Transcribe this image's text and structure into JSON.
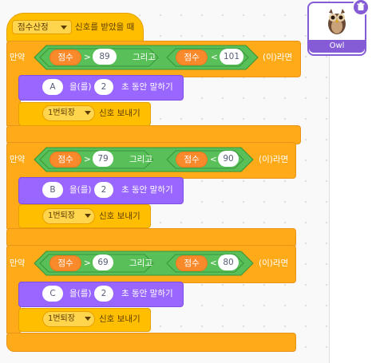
{
  "sprite": {
    "name": "Owl",
    "icon": "owl-image",
    "delete_icon": "trash-icon"
  },
  "hat": {
    "variable": "점수산정",
    "suffix": "신호를 받았을 때"
  },
  "if_blocks": [
    {
      "if_label": "만약",
      "then_label": "(이)라면",
      "and_label": "그리고",
      "cond1": {
        "var": "점수",
        "op": ">",
        "value": "89"
      },
      "cond2": {
        "var": "점수",
        "op": "<",
        "value": "101"
      },
      "say": {
        "text": "A",
        "mid": "을(를)",
        "secs": "2",
        "suffix": "초 동안 말하기"
      },
      "broadcast": {
        "message": "1번퇴장",
        "suffix": "신호 보내기"
      }
    },
    {
      "if_label": "만약",
      "then_label": "(이)라면",
      "and_label": "그리고",
      "cond1": {
        "var": "점수",
        "op": ">",
        "value": "79"
      },
      "cond2": {
        "var": "점수",
        "op": "<",
        "value": "90"
      },
      "say": {
        "text": "B",
        "mid": "을(를)",
        "secs": "2",
        "suffix": "초 동안 말하기"
      },
      "broadcast": {
        "message": "1번퇴장",
        "suffix": "신호 보내기"
      }
    },
    {
      "if_label": "만약",
      "then_label": "(이)라면",
      "and_label": "그리고",
      "cond1": {
        "var": "점수",
        "op": ">",
        "value": "69"
      },
      "cond2": {
        "var": "점수",
        "op": "<",
        "value": "80"
      },
      "say": {
        "text": "C",
        "mid": "을(를)",
        "secs": "2",
        "suffix": "초 동안 말하기"
      },
      "broadcast": {
        "message": "1번퇴장",
        "suffix": "신호 보내기"
      }
    }
  ],
  "colors": {
    "control": "#ffab19",
    "operators": "#59c059",
    "looks": "#9966ff",
    "events": "#ffbf00",
    "variables": "#ff8c1a",
    "sprite_accent": "#855cd6"
  }
}
